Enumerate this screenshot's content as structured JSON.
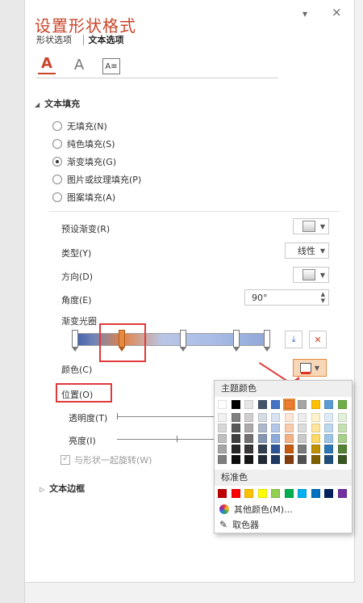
{
  "header": {
    "title": "设置形状格式",
    "tab1": "形状选项",
    "tab2": "文本选项",
    "minimize": "▾",
    "close": "×"
  },
  "icons": {
    "text_fill": "A",
    "text_outline": "A",
    "text_box": "A≡"
  },
  "fill": {
    "section": "文本填充",
    "options": [
      {
        "label": "无填充(N)",
        "checked": false
      },
      {
        "label": "纯色填充(S)",
        "checked": false
      },
      {
        "label": "渐变填充(G)",
        "checked": true
      },
      {
        "label": "图片或纹理填充(P)",
        "checked": false
      },
      {
        "label": "图案填充(A)",
        "checked": false
      }
    ],
    "preset_label": "预设渐变(R)",
    "type_label": "类型(Y)",
    "type_value": "线性",
    "direction_label": "方向(D)",
    "angle_label": "角度(E)",
    "angle_value": "90°",
    "stops_label": "渐变光圈",
    "color_label": "颜色(C)",
    "position_label": "位置(O)",
    "transparency_label": "透明度(T)",
    "brightness_label": "亮度(I)",
    "rotate_label": "与形状一起旋转(W)"
  },
  "border_section": "文本边框",
  "popup": {
    "theme_colors": "主题颜色",
    "standard_colors": "标准色",
    "more_colors": "其他颜色(M)...",
    "eyedropper": "取色器",
    "theme_top": [
      "#ffffff",
      "#000000",
      "#e7e6e6",
      "#44546a",
      "#4472c4",
      "#ed7d31",
      "#a5a5a5",
      "#ffc000",
      "#5b9bd5",
      "#70ad47"
    ],
    "theme_shades": [
      [
        "#f2f2f2",
        "#7f7f7f",
        "#d0cece",
        "#d6dce4",
        "#d9e2f3",
        "#fbe5d5",
        "#ededed",
        "#fff2cc",
        "#deebf6",
        "#e2efd9"
      ],
      [
        "#d8d8d8",
        "#595959",
        "#aeaaaa",
        "#adb9ca",
        "#b4c6e7",
        "#f7cbac",
        "#dbdbdb",
        "#fee599",
        "#bdd7ee",
        "#c5e0b3"
      ],
      [
        "#bfbfbf",
        "#3f3f3f",
        "#757070",
        "#8496b0",
        "#8eaadb",
        "#f4b183",
        "#c9c9c9",
        "#ffd965",
        "#9cc3e5",
        "#a8d08d"
      ],
      [
        "#a5a5a5",
        "#262626",
        "#3a3838",
        "#323f4f",
        "#2f5496",
        "#c55a11",
        "#7b7b7b",
        "#bf9000",
        "#2e75b5",
        "#538135"
      ],
      [
        "#7f7f7f",
        "#0c0c0c",
        "#171616",
        "#222a35",
        "#1f3864",
        "#833c0b",
        "#525252",
        "#7f6000",
        "#1e4e79",
        "#375623"
      ]
    ],
    "standard": [
      "#c00000",
      "#ff0000",
      "#ffc000",
      "#ffff00",
      "#92d050",
      "#00b050",
      "#00b0f0",
      "#0070c0",
      "#002060",
      "#7030a0"
    ]
  }
}
